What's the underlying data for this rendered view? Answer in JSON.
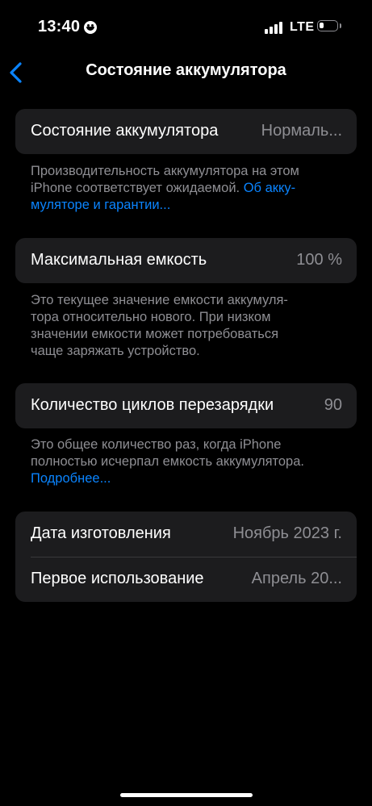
{
  "status_bar": {
    "time": "13:40",
    "network": "LTE",
    "icons": [
      "smiley-face-icon",
      "signal-bars-icon",
      "battery-icon"
    ]
  },
  "nav": {
    "title": "Состояние аккумулятора",
    "back_icon": "chevron-left-icon"
  },
  "battery_health": {
    "label": "Состояние аккумулятора",
    "value": "Нормаль...",
    "footnote_line1": "Производительность аккумулятора на этом",
    "footnote_line2_text": "iPhone соответствует ожидаемой. ",
    "footnote_line2_link": "Об акку-",
    "footnote_line3_link": "муляторе и гарантии..."
  },
  "max_capacity": {
    "label": "Максимальная емкость",
    "value": "100 %",
    "footnote_lines": [
      "Это текущее значение емкости аккумуля-",
      "тора относительно нового. При низком",
      "значении емкости может потребоваться",
      "чаще заряжать устройство."
    ]
  },
  "cycle_count": {
    "label": "Количество циклов перезарядки",
    "value": "90",
    "footnote_line1": "Это общее количество раз, когда iPhone",
    "footnote_line2": "полностью исчерпал емкость аккумулятора.",
    "footnote_link": "Подробнее..."
  },
  "dates": {
    "manufacture_label": "Дата изготовления",
    "manufacture_value": "Ноябрь 2023 г.",
    "first_use_label": "Первое использование",
    "first_use_value": "Апрель 20..."
  },
  "colors": {
    "background": "#000000",
    "card": "#1c1c1e",
    "accent": "#0a84ff",
    "secondary_text": "#8e8e93"
  }
}
